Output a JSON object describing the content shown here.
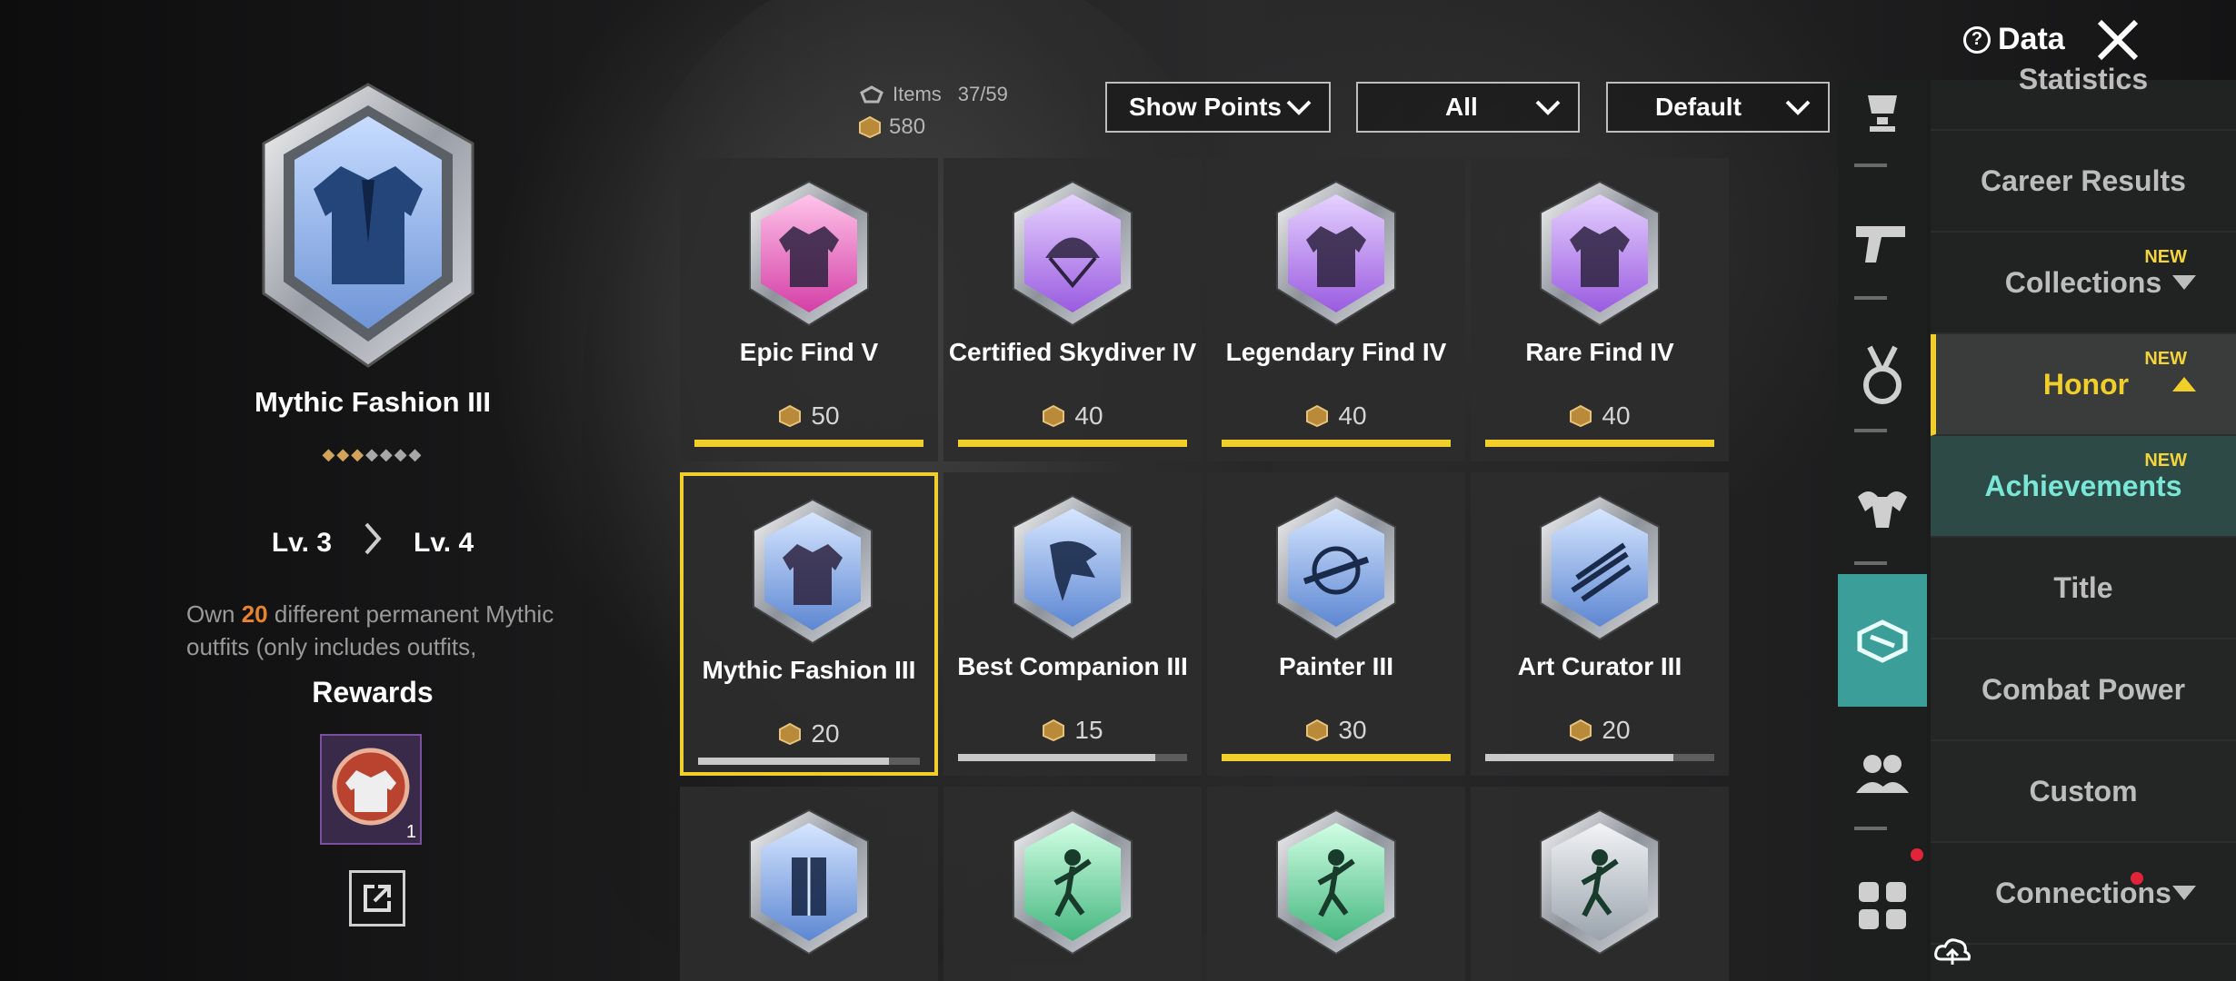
{
  "header": {
    "data_label": "Data"
  },
  "stats": {
    "items_label": "Items",
    "items_value": "37/59",
    "points_value": "580"
  },
  "filters": [
    {
      "label": "Show Points"
    },
    {
      "label": "All"
    },
    {
      "label": "Default"
    }
  ],
  "selected": {
    "title": "Mythic Fashion III",
    "level_from": "Lv. 3",
    "level_to": "Lv. 4",
    "stars_total": 7,
    "stars_filled": 3,
    "desc_prefix": "Own",
    "desc_highlight": "20",
    "desc_line1_rest": "different permanent Mythic",
    "desc_line2": "outfits (only includes outfits,",
    "rewards_title": "Rewards",
    "reward_qty": "1"
  },
  "cards": [
    {
      "name": "Epic Find V",
      "points": "50",
      "progress": 1.0,
      "bar_color": "#f1cf2b",
      "badge": "pink",
      "icon": "jacket-icon"
    },
    {
      "name": "Certified Skydiver IV",
      "points": "40",
      "progress": 1.0,
      "bar_color": "#f1cf2b",
      "badge": "purple",
      "icon": "parachute-icon"
    },
    {
      "name": "Legendary Find IV",
      "points": "40",
      "progress": 1.0,
      "bar_color": "#f1cf2b",
      "badge": "purple",
      "icon": "jacket-icon"
    },
    {
      "name": "Rare Find IV",
      "points": "40",
      "progress": 1.0,
      "bar_color": "#f1cf2b",
      "badge": "purple",
      "icon": "jacket-icon"
    },
    {
      "name": "Mythic Fashion III",
      "points": "20",
      "progress": 0.86,
      "bar_color": "#c9c9c9",
      "badge": "blue",
      "icon": "jacket-icon",
      "selected": true
    },
    {
      "name": "Best Companion III",
      "points": "15",
      "progress": 0.86,
      "bar_color": "#c9c9c9",
      "badge": "blue",
      "icon": "eagle-icon"
    },
    {
      "name": "Painter III",
      "points": "30",
      "progress": 1.0,
      "bar_color": "#f1cf2b",
      "badge": "blue",
      "icon": "crosshair-gun-icon"
    },
    {
      "name": "Art Curator III",
      "points": "20",
      "progress": 0.82,
      "bar_color": "#c9c9c9",
      "badge": "blue",
      "icon": "guns-icon"
    },
    {
      "name": "",
      "points": "",
      "progress": 0,
      "bar_color": "#c9c9c9",
      "badge": "blue",
      "icon": "door-icon"
    },
    {
      "name": "",
      "points": "",
      "progress": 0,
      "bar_color": "#c9c9c9",
      "badge": "green",
      "icon": "dance-icon"
    },
    {
      "name": "",
      "points": "",
      "progress": 0,
      "bar_color": "#c9c9c9",
      "badge": "green",
      "icon": "dance-icon"
    },
    {
      "name": "",
      "points": "",
      "progress": 0,
      "bar_color": "#c9c9c9",
      "badge": "silver",
      "icon": "dance-icon"
    }
  ],
  "menu": {
    "statistics": "Statistics",
    "career_results": "Career Results",
    "collections": "Collections",
    "honor": "Honor",
    "achievements": "Achievements",
    "title": "Title",
    "combat_power": "Combat Power",
    "custom": "Custom",
    "connections": "Connections",
    "new_tag": "NEW"
  },
  "colors": {
    "accent_yellow": "#f1cf2b",
    "accent_teal": "#3b9e98",
    "highlight_orange": "#e8832c"
  }
}
